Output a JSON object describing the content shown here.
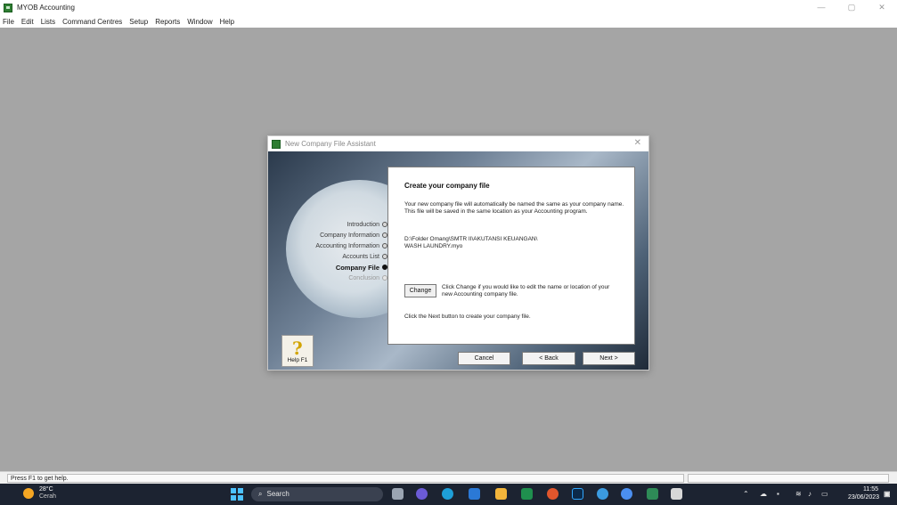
{
  "app": {
    "title": "MYOB Accounting",
    "window_controls": [
      "—",
      "▢",
      "✕"
    ]
  },
  "menu": [
    "File",
    "Edit",
    "Lists",
    "Command Centres",
    "Setup",
    "Reports",
    "Window",
    "Help"
  ],
  "dialog": {
    "title": "New Company File Assistant",
    "steps": [
      {
        "label": "Introduction",
        "state": "done"
      },
      {
        "label": "Company Information",
        "state": "done"
      },
      {
        "label": "Accounting Information",
        "state": "done"
      },
      {
        "label": "Accounts List",
        "state": "done"
      },
      {
        "label": "Company File",
        "state": "active"
      },
      {
        "label": "Conclusion",
        "state": "pending"
      }
    ],
    "panel": {
      "heading": "Create your company file",
      "paragraph": "Your new company file will automatically be named the same as your company name.  This file will be saved in the same location as your Accounting program.",
      "path_line1": "D:\\Folder Omang\\SMTR II\\AKUTANSI KEUANGAN\\",
      "path_line2": "WASH LAUNDRY.myo",
      "change_label": "Change",
      "change_text": "Click Change if you would like to edit the name or location of your new Accounting company file.",
      "next_text": "Click the Next button to create your company file."
    },
    "help_label": "Help F1",
    "buttons": {
      "cancel": "Cancel",
      "back": "< Back",
      "next": "Next >"
    }
  },
  "status_bar": {
    "text": "Press F1 to get help."
  },
  "taskbar": {
    "weather_temp": "28°C",
    "weather_desc": "Cerah",
    "search_label": "Search",
    "clock_time": "11:55",
    "clock_date": "23/06/2023"
  }
}
